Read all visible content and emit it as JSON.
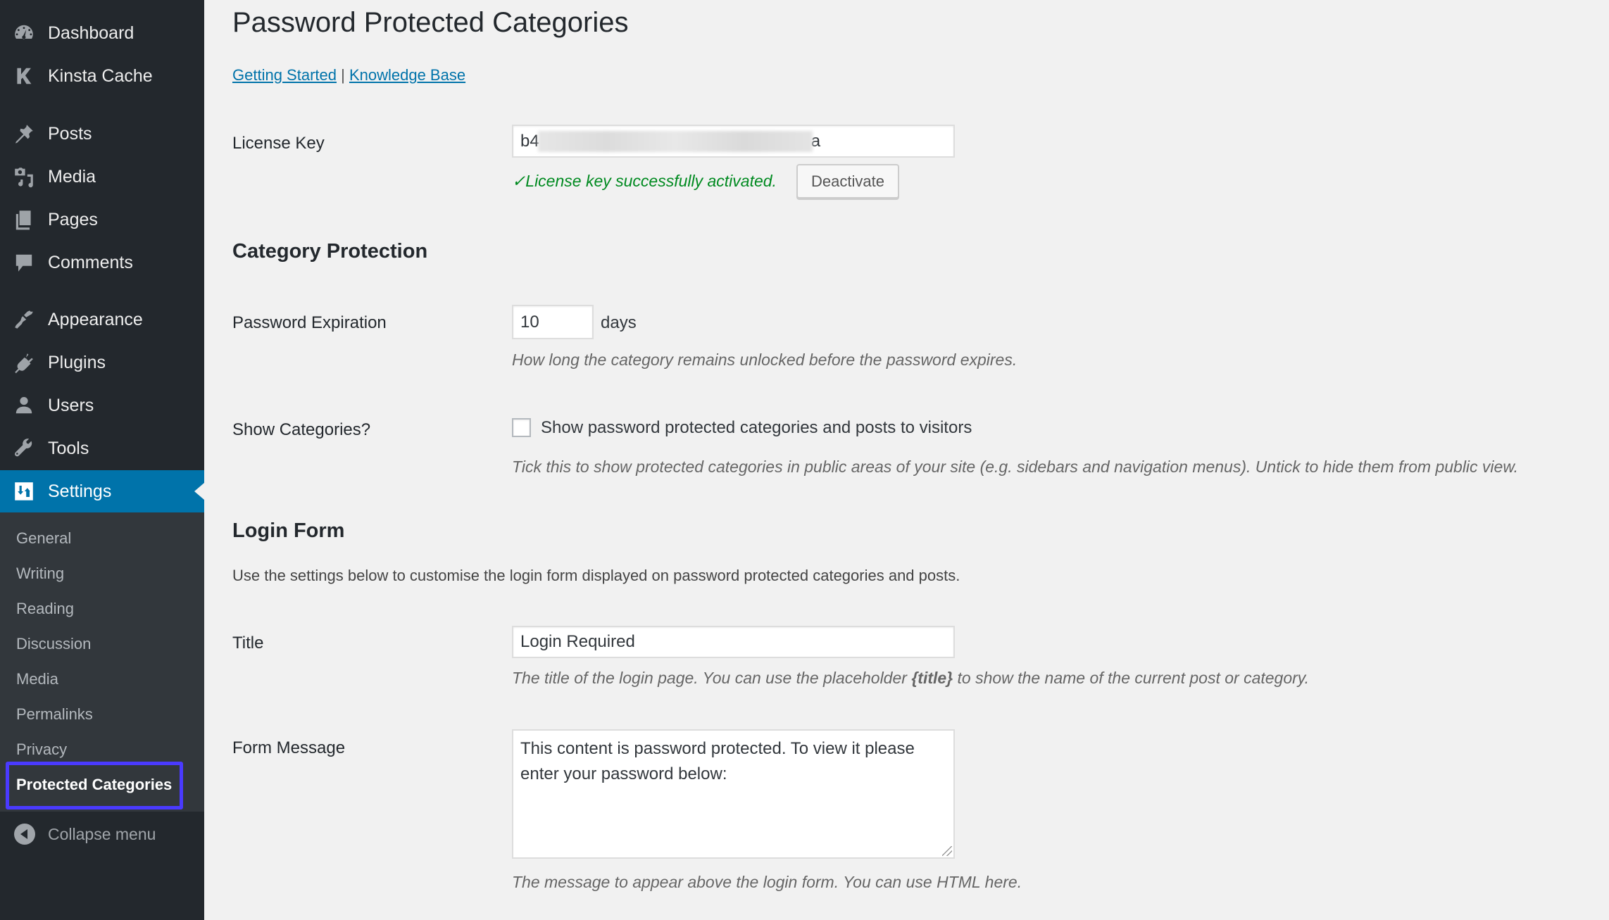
{
  "sidebar": {
    "items": [
      {
        "label": "Dashboard",
        "icon": "dashboard-icon"
      },
      {
        "label": "Kinsta Cache",
        "icon": "kinsta-icon"
      },
      {
        "label": "Posts",
        "icon": "pin-icon"
      },
      {
        "label": "Media",
        "icon": "media-icon"
      },
      {
        "label": "Pages",
        "icon": "pages-icon"
      },
      {
        "label": "Comments",
        "icon": "comment-icon"
      },
      {
        "label": "Appearance",
        "icon": "brush-icon"
      },
      {
        "label": "Plugins",
        "icon": "plug-icon"
      },
      {
        "label": "Users",
        "icon": "user-icon"
      },
      {
        "label": "Tools",
        "icon": "wrench-icon"
      },
      {
        "label": "Settings",
        "icon": "settings-icon",
        "active": true
      }
    ],
    "submenu": [
      {
        "label": "General"
      },
      {
        "label": "Writing"
      },
      {
        "label": "Reading"
      },
      {
        "label": "Discussion"
      },
      {
        "label": "Media"
      },
      {
        "label": "Permalinks"
      },
      {
        "label": "Privacy"
      },
      {
        "label": "Protected Categories",
        "current": true
      }
    ],
    "collapse_label": "Collapse menu"
  },
  "page": {
    "title": "Password Protected Categories",
    "links": {
      "getting_started": "Getting Started",
      "separator": "|",
      "knowledge_base": "Knowledge Base"
    }
  },
  "license": {
    "label": "License Key",
    "value_prefix": "b4",
    "value_suffix": "a",
    "success_message": "✓License key successfully activated.",
    "deactivate_label": "Deactivate"
  },
  "category_protection": {
    "heading": "Category Protection",
    "password_expiration": {
      "label": "Password Expiration",
      "value": "10",
      "unit": "days",
      "description": "How long the category remains unlocked before the password expires."
    },
    "show_categories": {
      "label": "Show Categories?",
      "checked": false,
      "checkbox_label": "Show password protected categories and posts to visitors",
      "description": "Tick this to show protected categories in public areas of your site (e.g. sidebars and navigation menus). Untick to hide them from public view."
    }
  },
  "login_form": {
    "heading": "Login Form",
    "intro": "Use the settings below to customise the login form displayed on password protected categories and posts.",
    "title": {
      "label": "Title",
      "value": "Login Required",
      "description_before": "The title of the login page. You can use the placeholder ",
      "description_placeholder": "{title}",
      "description_after": " to show the name of the current post or category."
    },
    "form_message": {
      "label": "Form Message",
      "value": "This content is password protected. To view it please enter your password below:",
      "description": "The message to appear above the login form. You can use HTML here."
    }
  },
  "colors": {
    "sidebar_bg": "#23282d",
    "submenu_bg": "#32373c",
    "active_bg": "#0073aa",
    "link": "#0073aa",
    "success": "#008a20",
    "highlight_box": "#4a3aff"
  }
}
